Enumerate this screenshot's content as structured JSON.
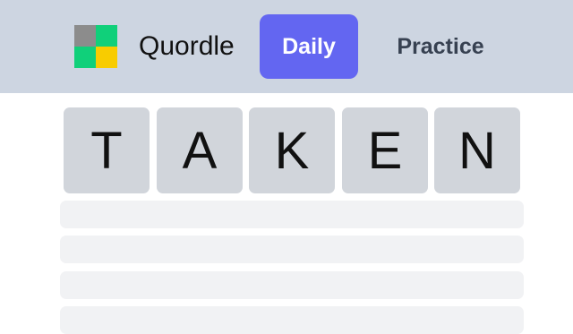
{
  "header": {
    "brand": "Quordle",
    "logo_icon": "quordle-logo-icon",
    "tabs": [
      {
        "label": "Daily",
        "active": true
      },
      {
        "label": "Practice",
        "active": false
      }
    ],
    "colors": {
      "header_bg": "#cdd5e1",
      "active_tab": "#6366f1",
      "logo": [
        "#8c8c8c",
        "#10d07a",
        "#10d07a",
        "#f8cc00"
      ]
    }
  },
  "board": {
    "guess": [
      "T",
      "A",
      "K",
      "E",
      "N"
    ],
    "empty_rows": 4
  }
}
